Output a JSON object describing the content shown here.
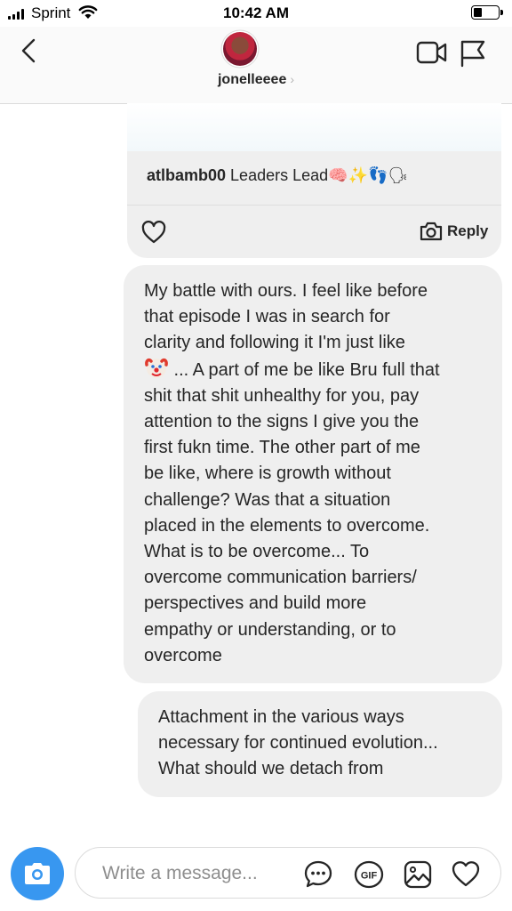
{
  "status_bar": {
    "carrier": "Sprint",
    "time": "10:42 AM",
    "battery_level": 0.3
  },
  "header": {
    "username": "jonelleeee",
    "chevron": "›",
    "icons": [
      "back-chevron-icon",
      "video-call-icon",
      "flag-icon"
    ]
  },
  "shared_post": {
    "author": "atlbamb00",
    "caption": " Leaders Lead🧠✨👣🗣",
    "reply_label": "Reply",
    "icons": [
      "heart-icon",
      "camera-icon"
    ]
  },
  "messages": [
    {
      "before_emoji": "My battle with ours. I feel like before\nthat episode I was in search for\nclarity and following it I'm just like\n",
      "emoji": "clown-emoji",
      "after_emoji": " ... A part of me be like Bru full that\nshit that shit unhealthy for you, pay\nattention to the signs I give you the\nfirst fukn time. The other part of me\nbe like, where is growth without\nchallenge? Was that a situation\nplaced in the elements to overcome.\nWhat is to be overcome... To\novercome  communication barriers/\nperspectives and build more\nempathy or understanding, or to\novercome"
    },
    {
      "text": "Attachment in the various ways\nnecessary for continued evolution...\nWhat should we detach from"
    }
  ],
  "composer": {
    "placeholder": "Write a message...",
    "value": "",
    "icons": [
      "camera-icon",
      "quick-reply-icon",
      "gif-icon",
      "gallery-icon",
      "heart-icon"
    ],
    "accent_color": "#3897f0"
  }
}
